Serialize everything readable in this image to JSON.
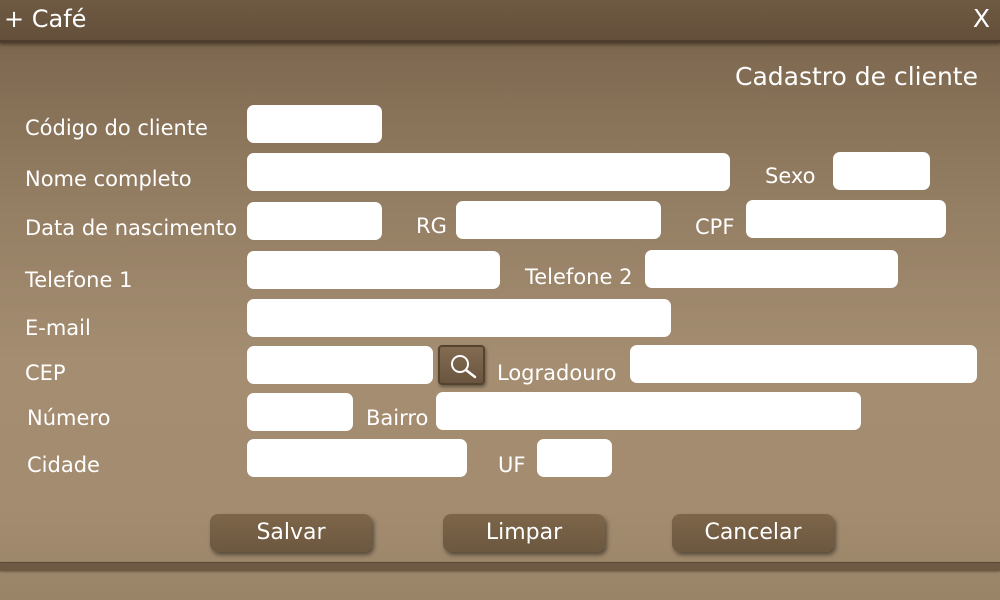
{
  "window": {
    "title": "+ Café",
    "close_label": "X"
  },
  "form": {
    "title": "Cadastro de cliente",
    "labels": {
      "codigo": "Código do cliente",
      "nome": "Nome completo",
      "sexo": "Sexo",
      "nascimento": "Data de nascimento",
      "rg": "RG",
      "cpf": "CPF",
      "telefone1": "Telefone 1",
      "telefone2": "Telefone 2",
      "email": "E-mail",
      "cep": "CEP",
      "logradouro": "Logradouro",
      "numero": "Número",
      "bairro": "Bairro",
      "cidade": "Cidade",
      "uf": "UF"
    },
    "values": {
      "codigo": "",
      "nome": "",
      "sexo": "",
      "nascimento": "",
      "rg": "",
      "cpf": "",
      "telefone1": "",
      "telefone2": "",
      "email": "",
      "cep": "",
      "logradouro": "",
      "numero": "",
      "bairro": "",
      "cidade": "",
      "uf": ""
    },
    "cep_search_icon": "magnifier-icon"
  },
  "actions": {
    "save_label": "Salvar",
    "clear_label": "Limpar",
    "cancel_label": "Cancelar"
  },
  "colors": {
    "title_bar": "#6e5a43",
    "background": "#a38c70",
    "button": "#755f45",
    "field": "#ffffff",
    "text": "#ffffff"
  }
}
